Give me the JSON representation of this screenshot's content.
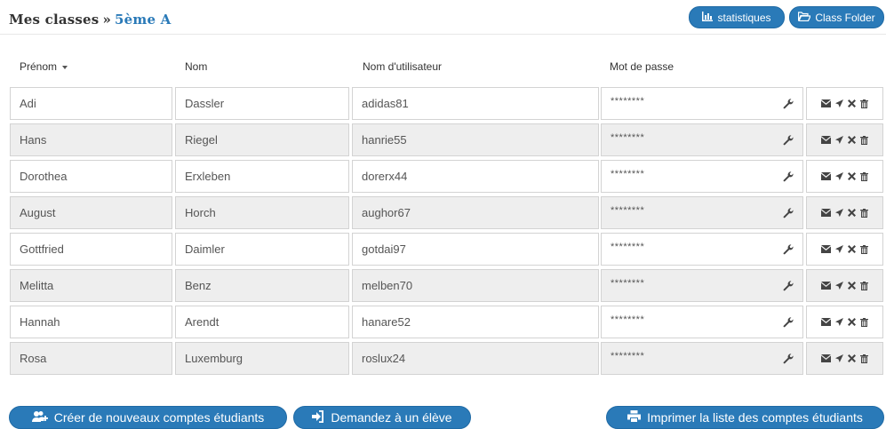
{
  "breadcrumb": {
    "root": "Mes classes",
    "separator": "»",
    "current": "5ème A"
  },
  "header_buttons": {
    "statistics": "statistiques",
    "class_folder": "Class Folder"
  },
  "columns": {
    "first_name": "Prénom",
    "last_name": "Nom",
    "username": "Nom d'utilisateur",
    "password": "Mot de passe"
  },
  "students": [
    {
      "first": "Adi",
      "last": "Dassler",
      "user": "adidas81",
      "pwd": "********"
    },
    {
      "first": "Hans",
      "last": "Riegel",
      "user": "hanrie55",
      "pwd": "********"
    },
    {
      "first": "Dorothea",
      "last": "Erxleben",
      "user": "dorerx44",
      "pwd": "********"
    },
    {
      "first": "August",
      "last": "Horch",
      "user": "aughor67",
      "pwd": "********"
    },
    {
      "first": "Gottfried",
      "last": "Daimler",
      "user": "gotdai97",
      "pwd": "********"
    },
    {
      "first": "Melitta",
      "last": "Benz",
      "user": "melben70",
      "pwd": "********"
    },
    {
      "first": "Hannah",
      "last": "Arendt",
      "user": "hanare52",
      "pwd": "********"
    },
    {
      "first": "Rosa",
      "last": "Luxemburg",
      "user": "roslux24",
      "pwd": "********"
    }
  ],
  "footer_buttons": {
    "create": "Créer de nouveaux comptes étudiants",
    "ask": "Demandez à un élève",
    "print": "Imprimer la liste des comptes étudiants"
  },
  "row_icons": [
    "envelope-icon",
    "send-icon",
    "remove-icon",
    "trash-icon"
  ],
  "colors": {
    "accent": "#2a7ab8",
    "row_alt": "#eeeeee",
    "border": "#d3d3d3"
  }
}
